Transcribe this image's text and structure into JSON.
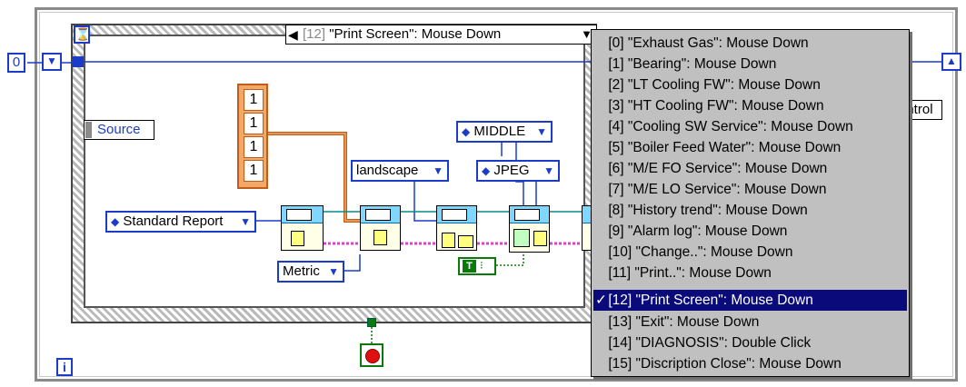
{
  "constants": {
    "loop_count": "0",
    "array_values": [
      "1",
      "1",
      "1",
      "1"
    ],
    "iteration_label": "i"
  },
  "event_structure": {
    "selector_index": "[12]",
    "selector_text": "\"Print Screen\": Mouse Down",
    "prev_arrow": "◀",
    "dropdown_arrow": "▼",
    "hourglass_icon": "⌛"
  },
  "terminals": {
    "source_label": "Source",
    "control_fragment": "ontrol"
  },
  "enums": {
    "report_type": "Standard Report",
    "orientation": "landscape",
    "units": "Metric",
    "alignment": "MIDDLE",
    "image_format": "JPEG",
    "updown_glyph": "◆",
    "dropdown_glyph": "▼"
  },
  "boolean_constant": {
    "label": "T"
  },
  "menu": {
    "check_mark": "✓",
    "selected_index": 12,
    "items": [
      "[0] \"Exhaust Gas\": Mouse Down",
      "[1] \"Bearing\": Mouse Down",
      "[2] \"LT Cooling FW\": Mouse Down",
      "[3] \"HT Cooling FW\": Mouse Down",
      "[4] \"Cooling SW Service\": Mouse Down",
      "[5] \"Boiler Feed Water\": Mouse Down",
      "[6] \"M/E FO Service\": Mouse Down",
      "[7] \"M/E LO Service\": Mouse Down",
      "[8] \"History trend\": Mouse Down",
      "[9] \"Alarm log\": Mouse Down",
      "[10] \"Change..\": Mouse Down",
      "[11] \"Print..\": Mouse Down",
      "[12] \"Print Screen\": Mouse Down",
      "[13] \"Exit\": Mouse Down",
      "[14] \"DIAGNOSIS\": Double Click",
      "[15] \"Discription Close\": Mouse Down"
    ]
  },
  "colors": {
    "numeric_blue": "#1a3cc8",
    "array_orange": "#c35c1a",
    "boolean_green": "#0a7a0a",
    "menu_highlight": "#0a0a7a",
    "menu_background": "#c0c0c0"
  }
}
